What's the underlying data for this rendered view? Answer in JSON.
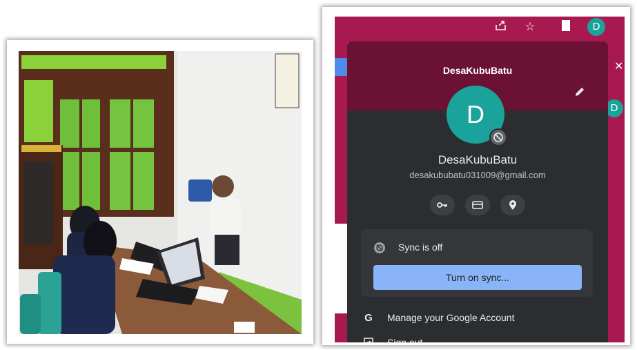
{
  "profile_menu": {
    "header_name": "DesaKubuBatu",
    "avatar_letter": "D",
    "name": "DesaKubuBatu",
    "email": "desakububatu031009@gmail.com",
    "sync_status": "Sync is off",
    "sync_button": "Turn on sync...",
    "manage_account": "Manage your Google Account",
    "sign_out": "Sign out",
    "quick_icons": [
      "key-icon",
      "card-icon",
      "location-icon"
    ]
  },
  "browser_toolbar": {
    "avatar_letter": "D",
    "icons": [
      "share-icon",
      "star-icon",
      "sidepanel-icon"
    ]
  },
  "colors": {
    "brand_magenta": "#a8194f",
    "panel_header": "#6b1234",
    "avatar_teal": "#1aa39a",
    "sync_button": "#8ab4f8"
  }
}
